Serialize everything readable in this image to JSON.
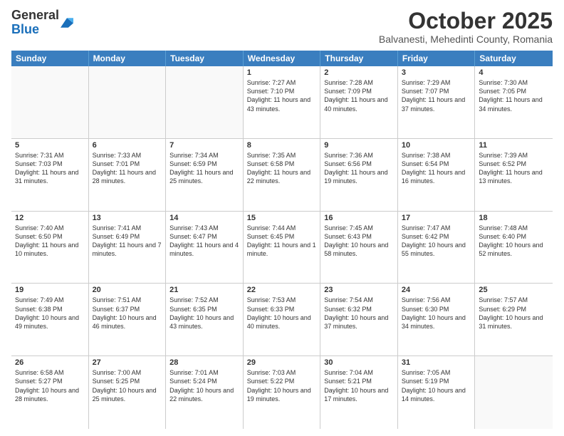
{
  "header": {
    "logo_general": "General",
    "logo_blue": "Blue",
    "month_title": "October 2025",
    "location": "Balvanesti, Mehedinti County, Romania"
  },
  "days_of_week": [
    "Sunday",
    "Monday",
    "Tuesday",
    "Wednesday",
    "Thursday",
    "Friday",
    "Saturday"
  ],
  "weeks": [
    [
      {
        "day": "",
        "text": ""
      },
      {
        "day": "",
        "text": ""
      },
      {
        "day": "",
        "text": ""
      },
      {
        "day": "1",
        "text": "Sunrise: 7:27 AM\nSunset: 7:10 PM\nDaylight: 11 hours and 43 minutes."
      },
      {
        "day": "2",
        "text": "Sunrise: 7:28 AM\nSunset: 7:09 PM\nDaylight: 11 hours and 40 minutes."
      },
      {
        "day": "3",
        "text": "Sunrise: 7:29 AM\nSunset: 7:07 PM\nDaylight: 11 hours and 37 minutes."
      },
      {
        "day": "4",
        "text": "Sunrise: 7:30 AM\nSunset: 7:05 PM\nDaylight: 11 hours and 34 minutes."
      }
    ],
    [
      {
        "day": "5",
        "text": "Sunrise: 7:31 AM\nSunset: 7:03 PM\nDaylight: 11 hours and 31 minutes."
      },
      {
        "day": "6",
        "text": "Sunrise: 7:33 AM\nSunset: 7:01 PM\nDaylight: 11 hours and 28 minutes."
      },
      {
        "day": "7",
        "text": "Sunrise: 7:34 AM\nSunset: 6:59 PM\nDaylight: 11 hours and 25 minutes."
      },
      {
        "day": "8",
        "text": "Sunrise: 7:35 AM\nSunset: 6:58 PM\nDaylight: 11 hours and 22 minutes."
      },
      {
        "day": "9",
        "text": "Sunrise: 7:36 AM\nSunset: 6:56 PM\nDaylight: 11 hours and 19 minutes."
      },
      {
        "day": "10",
        "text": "Sunrise: 7:38 AM\nSunset: 6:54 PM\nDaylight: 11 hours and 16 minutes."
      },
      {
        "day": "11",
        "text": "Sunrise: 7:39 AM\nSunset: 6:52 PM\nDaylight: 11 hours and 13 minutes."
      }
    ],
    [
      {
        "day": "12",
        "text": "Sunrise: 7:40 AM\nSunset: 6:50 PM\nDaylight: 11 hours and 10 minutes."
      },
      {
        "day": "13",
        "text": "Sunrise: 7:41 AM\nSunset: 6:49 PM\nDaylight: 11 hours and 7 minutes."
      },
      {
        "day": "14",
        "text": "Sunrise: 7:43 AM\nSunset: 6:47 PM\nDaylight: 11 hours and 4 minutes."
      },
      {
        "day": "15",
        "text": "Sunrise: 7:44 AM\nSunset: 6:45 PM\nDaylight: 11 hours and 1 minute."
      },
      {
        "day": "16",
        "text": "Sunrise: 7:45 AM\nSunset: 6:43 PM\nDaylight: 10 hours and 58 minutes."
      },
      {
        "day": "17",
        "text": "Sunrise: 7:47 AM\nSunset: 6:42 PM\nDaylight: 10 hours and 55 minutes."
      },
      {
        "day": "18",
        "text": "Sunrise: 7:48 AM\nSunset: 6:40 PM\nDaylight: 10 hours and 52 minutes."
      }
    ],
    [
      {
        "day": "19",
        "text": "Sunrise: 7:49 AM\nSunset: 6:38 PM\nDaylight: 10 hours and 49 minutes."
      },
      {
        "day": "20",
        "text": "Sunrise: 7:51 AM\nSunset: 6:37 PM\nDaylight: 10 hours and 46 minutes."
      },
      {
        "day": "21",
        "text": "Sunrise: 7:52 AM\nSunset: 6:35 PM\nDaylight: 10 hours and 43 minutes."
      },
      {
        "day": "22",
        "text": "Sunrise: 7:53 AM\nSunset: 6:33 PM\nDaylight: 10 hours and 40 minutes."
      },
      {
        "day": "23",
        "text": "Sunrise: 7:54 AM\nSunset: 6:32 PM\nDaylight: 10 hours and 37 minutes."
      },
      {
        "day": "24",
        "text": "Sunrise: 7:56 AM\nSunset: 6:30 PM\nDaylight: 10 hours and 34 minutes."
      },
      {
        "day": "25",
        "text": "Sunrise: 7:57 AM\nSunset: 6:29 PM\nDaylight: 10 hours and 31 minutes."
      }
    ],
    [
      {
        "day": "26",
        "text": "Sunrise: 6:58 AM\nSunset: 5:27 PM\nDaylight: 10 hours and 28 minutes."
      },
      {
        "day": "27",
        "text": "Sunrise: 7:00 AM\nSunset: 5:25 PM\nDaylight: 10 hours and 25 minutes."
      },
      {
        "day": "28",
        "text": "Sunrise: 7:01 AM\nSunset: 5:24 PM\nDaylight: 10 hours and 22 minutes."
      },
      {
        "day": "29",
        "text": "Sunrise: 7:03 AM\nSunset: 5:22 PM\nDaylight: 10 hours and 19 minutes."
      },
      {
        "day": "30",
        "text": "Sunrise: 7:04 AM\nSunset: 5:21 PM\nDaylight: 10 hours and 17 minutes."
      },
      {
        "day": "31",
        "text": "Sunrise: 7:05 AM\nSunset: 5:19 PM\nDaylight: 10 hours and 14 minutes."
      },
      {
        "day": "",
        "text": ""
      }
    ]
  ]
}
